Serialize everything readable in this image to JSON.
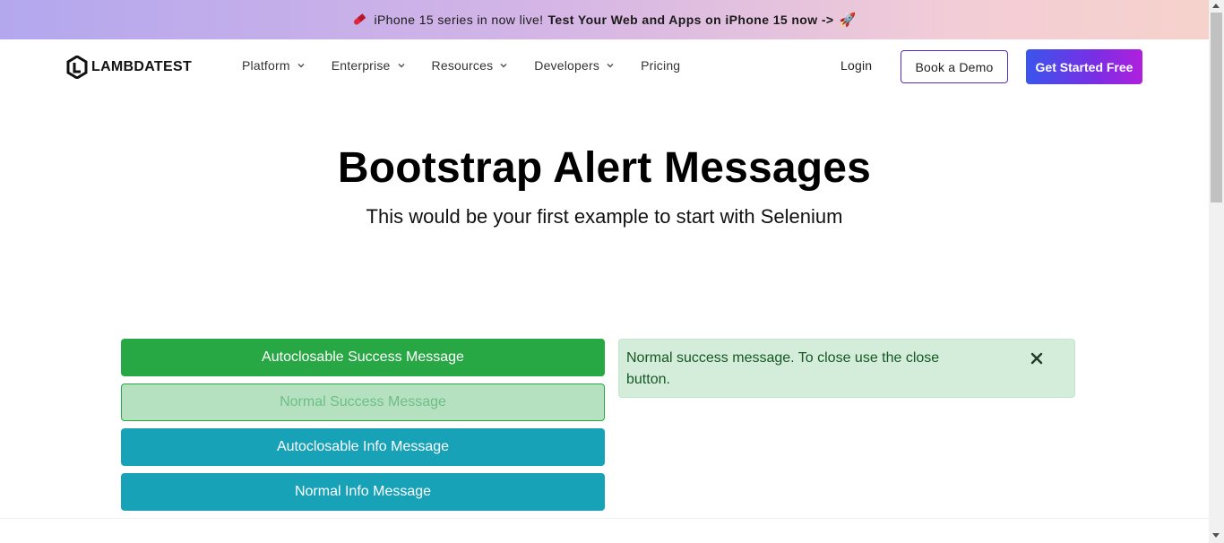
{
  "announcement": {
    "lead": "iPhone 15 series in now live!",
    "cta": "Test Your Web and Apps on iPhone 15 now ->",
    "icons": [
      "pill-icon",
      "rocket-icon"
    ]
  },
  "brand": {
    "logo_text": "LAMBDATEST"
  },
  "nav": {
    "items": [
      {
        "label": "Platform",
        "has_dropdown": true
      },
      {
        "label": "Enterprise",
        "has_dropdown": true
      },
      {
        "label": "Resources",
        "has_dropdown": true
      },
      {
        "label": "Developers",
        "has_dropdown": true
      },
      {
        "label": "Pricing",
        "has_dropdown": false
      }
    ],
    "login": "Login",
    "book_demo": "Book a Demo",
    "get_started": "Get Started Free"
  },
  "hero": {
    "title": "Bootstrap Alert Messages",
    "subtitle": "This would be your first example to start with Selenium"
  },
  "buttons": [
    {
      "label": "Autoclosable Success Message",
      "variant": "success"
    },
    {
      "label": "Normal Success Message",
      "variant": "success-faded"
    },
    {
      "label": "Autoclosable Info Message",
      "variant": "info"
    },
    {
      "label": "Normal Info Message",
      "variant": "info"
    }
  ],
  "alert": {
    "text": "Normal success message. To close use the close button.",
    "close_icon": "close-icon"
  },
  "colors": {
    "success": "#28a745",
    "info": "#17a2b8",
    "alert_bg": "#d4edda",
    "alert_text": "#155724",
    "demo_border": "#5a2ac8"
  }
}
